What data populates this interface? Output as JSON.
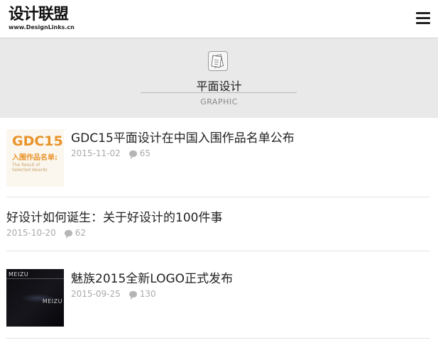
{
  "header": {
    "logo_text": "设计联盟",
    "logo_url_text": "www.DesignLinks.cn",
    "menu_icon": "hamburger-menu-icon"
  },
  "category": {
    "icon": "document-icon",
    "title": "平面设计",
    "subtitle": "GRAPHIC"
  },
  "articles": [
    {
      "title": "GDC15平面设计在中国入围作品名单公布",
      "date": "2015-11-02",
      "comments": "65",
      "thumb": {
        "line1": "GDC15",
        "line2": "入围作品名单:",
        "line3": "The Result of Selected Awards"
      }
    },
    {
      "title": "好设计如何诞生：关于好设计的100件事",
      "date": "2015-10-20",
      "comments": "62"
    },
    {
      "title": "魅族2015全新LOGO正式发布",
      "date": "2015-09-25",
      "comments": "130",
      "thumb": {
        "line1": "MEIZU",
        "line2": "MEIZU"
      }
    }
  ],
  "colors": {
    "banner_bg": "#e9e9e9",
    "accent_orange": "#e8932a",
    "meta_gray": "#aaaaaa"
  }
}
